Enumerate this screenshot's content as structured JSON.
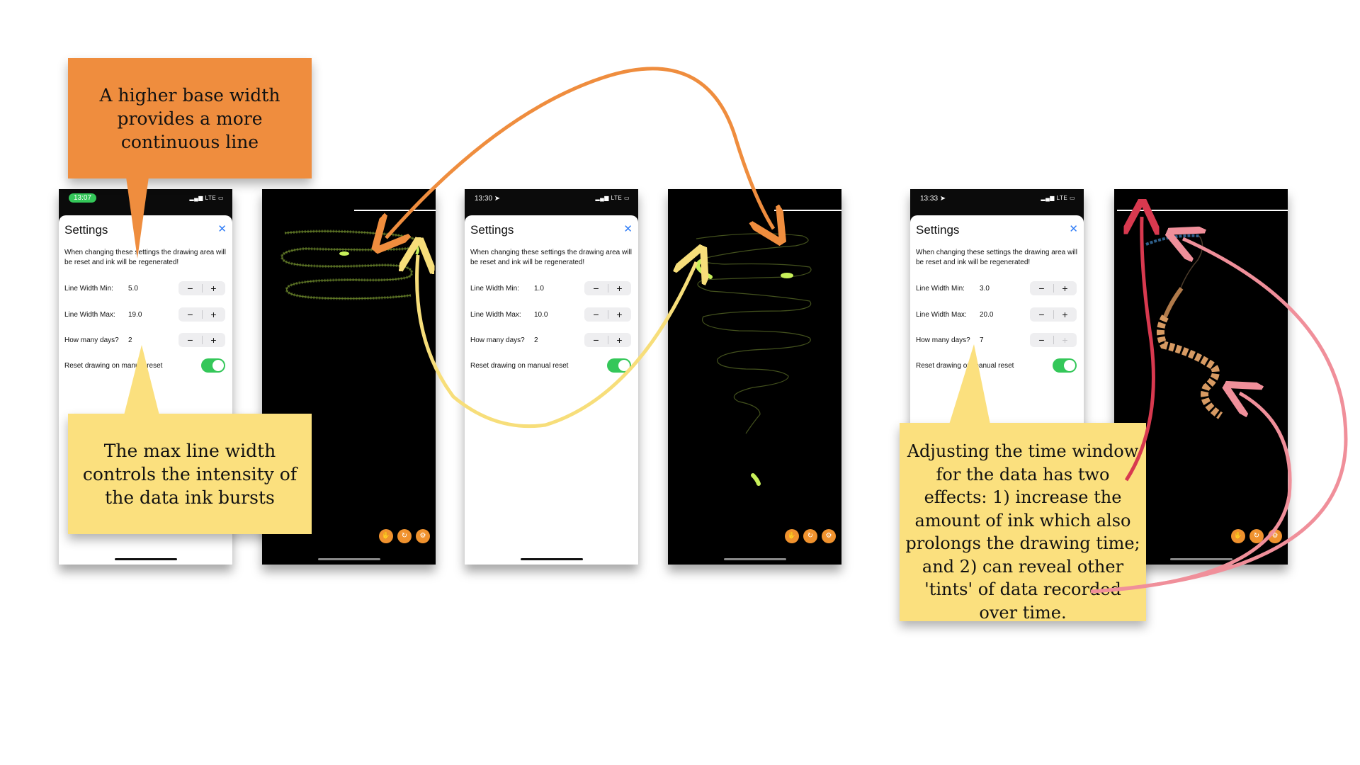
{
  "colors": {
    "orange": "#ef8d3e",
    "yellow": "#fbe07e",
    "pink": "#f08f9a",
    "red": "#d8394f",
    "toggle_green": "#34c759",
    "close_blue": "#2f7cf6"
  },
  "notes": {
    "orange_note": "A higher base width provides a more continuous line",
    "max_width_note": "The max line width controls the intensity of the data ink bursts",
    "time_window_note": "Adjusting the time window for the data has two effects: 1) increase the amount of ink which also prolongs the drawing time; and 2) can reveal other 'tints' of data recorded over time."
  },
  "settings_screens": [
    {
      "time": "13:07",
      "status": "LTE",
      "title": "Settings",
      "close_icon": "✕",
      "description": "When changing these settings the drawing area will be reset and ink will be regenerated!",
      "line_width_min_label": "Line Width Min:",
      "line_width_min_value": "5.0",
      "line_width_max_label": "Line Width Max:",
      "line_width_max_value": "19.0",
      "days_label": "How many days?",
      "days_value": "2",
      "reset_label": "Reset drawing on manual reset",
      "minus": "−",
      "plus": "+"
    },
    {
      "time": "13:30 ➤",
      "status": "LTE",
      "title": "Settings",
      "close_icon": "✕",
      "description": "When changing these settings the drawing area will be reset and ink will be regenerated!",
      "line_width_min_label": "Line Width Min:",
      "line_width_min_value": "1.0",
      "line_width_max_label": "Line Width Max:",
      "line_width_max_value": "10.0",
      "days_label": "How many days?",
      "days_value": "2",
      "reset_label": "Reset drawing on manual reset",
      "minus": "−",
      "plus": "+"
    },
    {
      "time": "13:33 ➤",
      "status": "LTE",
      "title": "Settings",
      "close_icon": "✕",
      "description": "When changing these settings the drawing area will be reset and ink will be regenerated!",
      "line_width_min_label": "Line Width Min:",
      "line_width_min_value": "3.0",
      "line_width_max_label": "Line Width Max:",
      "line_width_max_value": "20.0",
      "days_label": "How many days?",
      "days_value": "7",
      "reset_label": "Reset drawing on manual reset",
      "minus": "−",
      "plus": "+"
    }
  ],
  "canvas_buttons": [
    "hand-icon",
    "reset-icon",
    "settings-icon"
  ],
  "canvas_button_glyphs": [
    "✋",
    "↻",
    "⚙"
  ]
}
